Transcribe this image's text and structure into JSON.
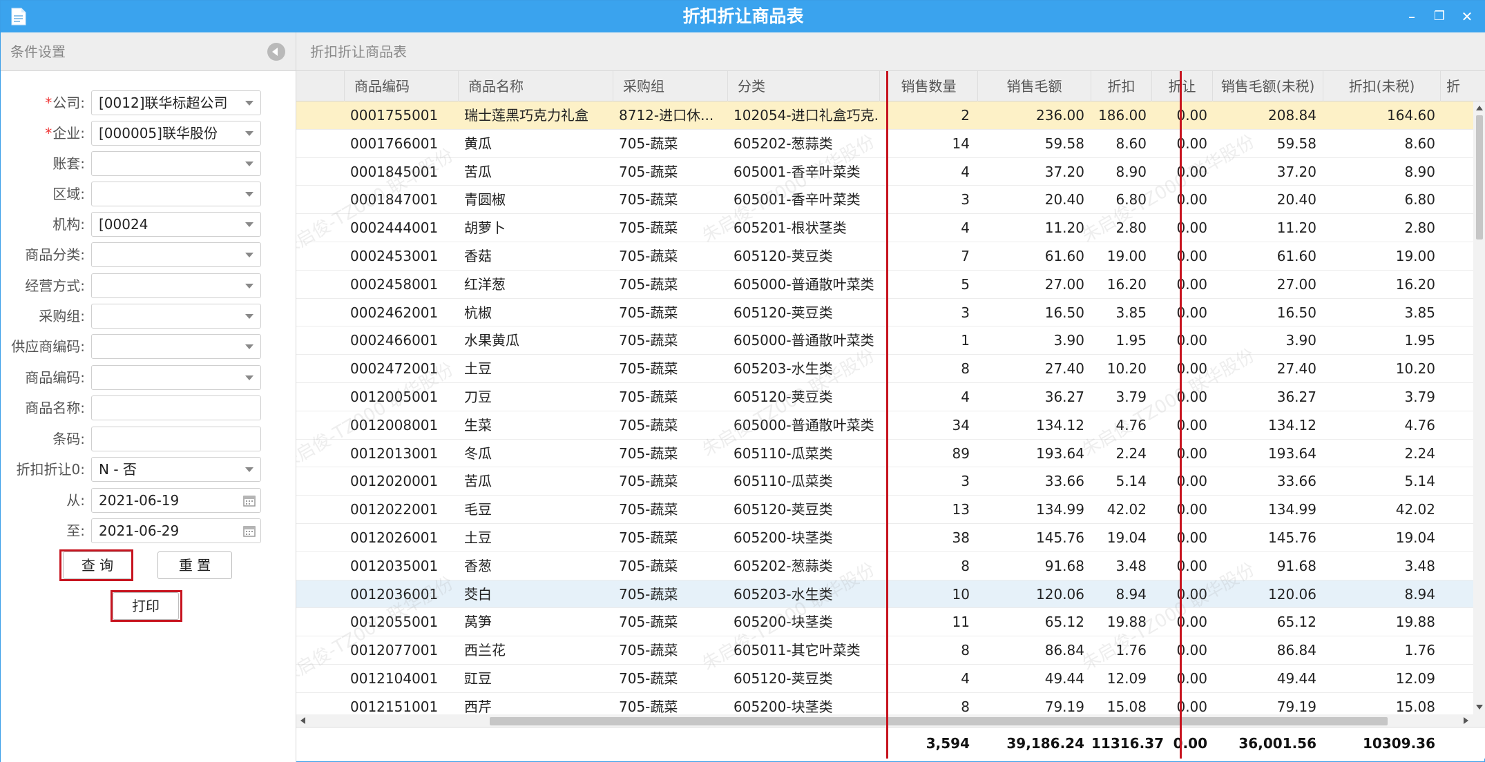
{
  "window": {
    "title": "折扣折让商品表",
    "minimize": "–",
    "restore": "❐",
    "close": "✕"
  },
  "left_panel": {
    "title": "条件设置",
    "fields": [
      {
        "label": "公司:",
        "required": true,
        "value": "[0012]联华标超公司",
        "type": "select"
      },
      {
        "label": "企业:",
        "required": true,
        "value": "[000005]联华股份",
        "type": "select"
      },
      {
        "label": "账套:",
        "required": false,
        "value": "",
        "type": "select"
      },
      {
        "label": "区域:",
        "required": false,
        "value": "",
        "type": "select"
      },
      {
        "label": "机构:",
        "required": false,
        "value": "[00024",
        "type": "select"
      },
      {
        "label": "商品分类:",
        "required": false,
        "value": "",
        "type": "select"
      },
      {
        "label": "经营方式:",
        "required": false,
        "value": "",
        "type": "select"
      },
      {
        "label": "采购组:",
        "required": false,
        "value": "",
        "type": "select"
      },
      {
        "label": "供应商编码:",
        "required": false,
        "value": "",
        "type": "select"
      },
      {
        "label": "商品编码:",
        "required": false,
        "value": "",
        "type": "select"
      },
      {
        "label": "商品名称:",
        "required": false,
        "value": "",
        "type": "text"
      },
      {
        "label": "条码:",
        "required": false,
        "value": "",
        "type": "text"
      },
      {
        "label": "折扣折让0:",
        "required": false,
        "value": "N - 否",
        "type": "select"
      },
      {
        "label": "从:",
        "required": false,
        "value": "2021-06-19",
        "type": "date"
      },
      {
        "label": "至:",
        "required": false,
        "value": "2021-06-29",
        "type": "date"
      }
    ],
    "buttons": {
      "query": "查 询",
      "reset": "重 置",
      "print": "打印"
    }
  },
  "main": {
    "breadcrumb": "折扣折让商品表",
    "columns": [
      "商品编码",
      "商品名称",
      "采购组",
      "分类",
      "销售数量",
      "销售毛额",
      "折扣",
      "折让",
      "销售毛额(未税)",
      "折扣(未税)",
      "折"
    ],
    "rows": [
      [
        "0001755001",
        "瑞士莲黑巧克力礼盒",
        "8712-进口休...",
        "102054-进口礼盒巧克...",
        "2",
        "236.00",
        "186.00",
        "0.00",
        "208.84",
        "164.60"
      ],
      [
        "0001766001",
        "黄瓜",
        "705-蔬菜",
        "605202-葱蒜类",
        "14",
        "59.58",
        "8.60",
        "0.00",
        "59.58",
        "8.60"
      ],
      [
        "0001845001",
        "苦瓜",
        "705-蔬菜",
        "605001-香辛叶菜类",
        "4",
        "37.20",
        "8.90",
        "0.00",
        "37.20",
        "8.90"
      ],
      [
        "0001847001",
        "青圆椒",
        "705-蔬菜",
        "605001-香辛叶菜类",
        "3",
        "20.40",
        "6.80",
        "0.00",
        "20.40",
        "6.80"
      ],
      [
        "0002444001",
        "胡萝卜",
        "705-蔬菜",
        "605201-根状茎类",
        "4",
        "11.20",
        "2.80",
        "0.00",
        "11.20",
        "2.80"
      ],
      [
        "0002453001",
        "香菇",
        "705-蔬菜",
        "605120-荚豆类",
        "7",
        "61.60",
        "19.00",
        "0.00",
        "61.60",
        "19.00"
      ],
      [
        "0002458001",
        "红洋葱",
        "705-蔬菜",
        "605000-普通散叶菜类",
        "5",
        "27.00",
        "16.20",
        "0.00",
        "27.00",
        "16.20"
      ],
      [
        "0002462001",
        "杭椒",
        "705-蔬菜",
        "605120-荚豆类",
        "3",
        "16.50",
        "3.85",
        "0.00",
        "16.50",
        "3.85"
      ],
      [
        "0002466001",
        "水果黄瓜",
        "705-蔬菜",
        "605000-普通散叶菜类",
        "1",
        "3.90",
        "1.95",
        "0.00",
        "3.90",
        "1.95"
      ],
      [
        "0002472001",
        "土豆",
        "705-蔬菜",
        "605203-水生类",
        "8",
        "27.40",
        "10.20",
        "0.00",
        "27.40",
        "10.20"
      ],
      [
        "0012005001",
        "刀豆",
        "705-蔬菜",
        "605120-荚豆类",
        "4",
        "36.27",
        "3.79",
        "0.00",
        "36.27",
        "3.79"
      ],
      [
        "0012008001",
        "生菜",
        "705-蔬菜",
        "605000-普通散叶菜类",
        "34",
        "134.12",
        "4.76",
        "0.00",
        "134.12",
        "4.76"
      ],
      [
        "0012013001",
        "冬瓜",
        "705-蔬菜",
        "605110-瓜菜类",
        "89",
        "193.64",
        "2.24",
        "0.00",
        "193.64",
        "2.24"
      ],
      [
        "0012020001",
        "苦瓜",
        "705-蔬菜",
        "605110-瓜菜类",
        "3",
        "33.66",
        "5.14",
        "0.00",
        "33.66",
        "5.14"
      ],
      [
        "0012022001",
        "毛豆",
        "705-蔬菜",
        "605120-荚豆类",
        "13",
        "134.99",
        "42.02",
        "0.00",
        "134.99",
        "42.02"
      ],
      [
        "0012026001",
        "土豆",
        "705-蔬菜",
        "605200-块茎类",
        "38",
        "145.76",
        "19.04",
        "0.00",
        "145.76",
        "19.04"
      ],
      [
        "0012035001",
        "香葱",
        "705-蔬菜",
        "605202-葱蒜类",
        "8",
        "91.68",
        "3.48",
        "0.00",
        "91.68",
        "3.48"
      ],
      [
        "0012036001",
        "茭白",
        "705-蔬菜",
        "605203-水生类",
        "10",
        "120.06",
        "8.94",
        "0.00",
        "120.06",
        "8.94"
      ],
      [
        "0012055001",
        "莴笋",
        "705-蔬菜",
        "605200-块茎类",
        "11",
        "65.12",
        "19.88",
        "0.00",
        "65.12",
        "19.88"
      ],
      [
        "0012077001",
        "西兰花",
        "705-蔬菜",
        "605011-其它叶菜类",
        "8",
        "86.84",
        "1.76",
        "0.00",
        "86.84",
        "1.76"
      ],
      [
        "0012104001",
        "豇豆",
        "705-蔬菜",
        "605120-荚豆类",
        "4",
        "49.44",
        "12.09",
        "0.00",
        "49.44",
        "12.09"
      ],
      [
        "0012151001",
        "西芹",
        "705-蔬菜",
        "605200-块茎类",
        "8",
        "79.19",
        "15.08",
        "0.00",
        "79.19",
        "15.08"
      ]
    ],
    "totals": {
      "qty": "3,594",
      "gross": "39,186.24",
      "discount": "11316.37",
      "allowance": "0.00",
      "gross_net": "36,001.56",
      "discount_net": "10309.36"
    }
  },
  "colors": {
    "titlebar": "#3aa3ee",
    "selected_row": "#fdf1c7",
    "hover_row": "#e6f1f9",
    "highlight_box": "#c7141f"
  }
}
